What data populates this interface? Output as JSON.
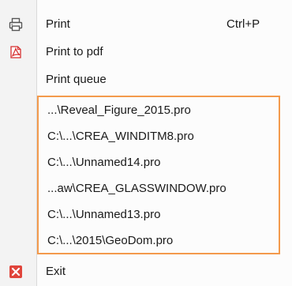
{
  "menu": {
    "items": [
      {
        "label": "Print",
        "shortcut": "Ctrl+P",
        "icon": "printer-icon"
      },
      {
        "label": "Print to pdf",
        "icon": "pdf-icon"
      },
      {
        "label": "Print queue"
      }
    ],
    "recent_files": [
      "...\\Reveal_Figure_2015.pro",
      "C:\\...\\CREA_WINDITM8.pro",
      "C:\\...\\Unnamed14.pro",
      "...aw\\CREA_GLASSWINDOW.pro",
      "C:\\...\\Unnamed13.pro",
      "C:\\...\\2015\\GeoDom.pro"
    ],
    "exit": {
      "label": "Exit",
      "icon": "exit-icon"
    }
  },
  "colors": {
    "highlight_border": "#f39a4c",
    "pdf_icon": "#d62f2f",
    "exit_icon": "#e0443b",
    "printer_icon": "#555555"
  }
}
